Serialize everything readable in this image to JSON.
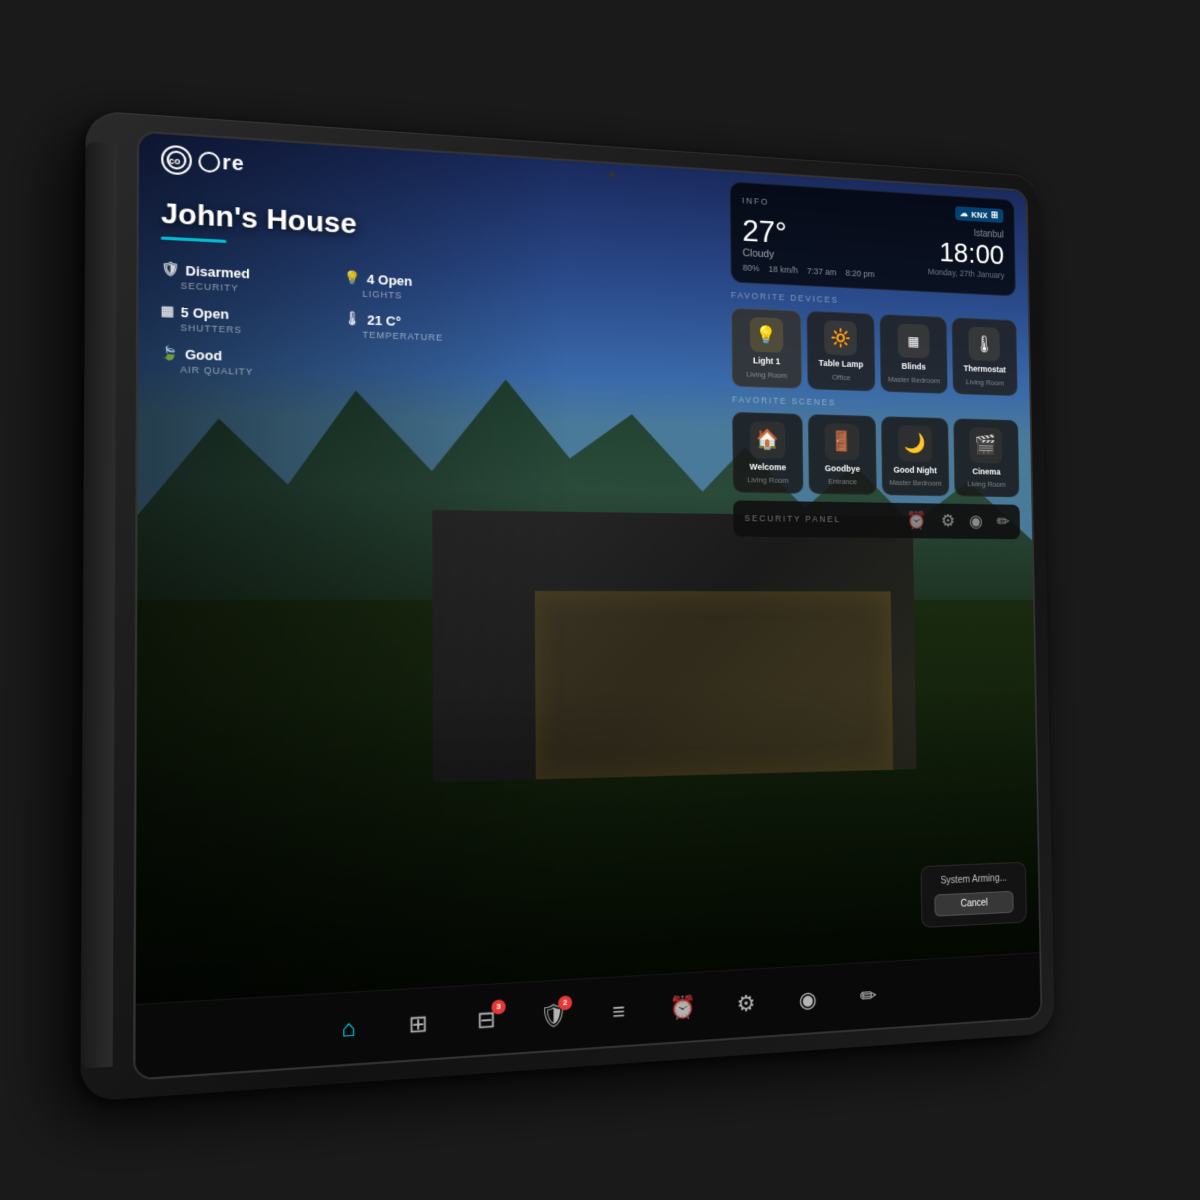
{
  "app": {
    "logo_text": "core",
    "brand": "#00bcd4"
  },
  "header": {
    "logo": "core"
  },
  "home": {
    "title": "John's House",
    "status": {
      "security_label": "SECURITY",
      "security_value": "Disarmed",
      "lights_label": "LIGHTS",
      "lights_value": "4 Open",
      "shutters_label": "SHUTTERS",
      "shutters_value": "5 Open",
      "temperature_label": "TEMPERATURE",
      "temperature_value": "21 C°",
      "air_quality_label": "AIR QUALITY",
      "air_quality_value": "Good"
    }
  },
  "weather": {
    "section_label": "INFO",
    "knx_label": "KNX",
    "temperature": "27°",
    "condition": "Cloudy",
    "humidity": "80%",
    "wind": "18 km/h",
    "sunrise": "7:37 am",
    "sunset": "8:20 pm",
    "city": "Istanbul",
    "time": "18:00",
    "date": "Monday, 27th January"
  },
  "favorite_devices": {
    "label": "FAVORITE DEVICES",
    "items": [
      {
        "name": "Light 1",
        "room": "Living Room",
        "icon": "💡",
        "active": true
      },
      {
        "name": "Table Lamp",
        "room": "Office",
        "icon": "🔆",
        "active": false
      },
      {
        "name": "Blinds",
        "room": "Master Bedroom",
        "icon": "▦",
        "active": false
      },
      {
        "name": "Thermostat",
        "room": "Living Room",
        "icon": "🌡",
        "active": false
      }
    ]
  },
  "favorite_scenes": {
    "label": "FAVORITE SCENES",
    "items": [
      {
        "name": "Welcome",
        "room": "Living Room",
        "icon": "🏠"
      },
      {
        "name": "Goodbye",
        "room": "Entrance",
        "icon": "🚪"
      },
      {
        "name": "Good Night",
        "room": "Master Bedroom",
        "icon": "🌙"
      },
      {
        "name": "Cinema",
        "room": "Living Room",
        "icon": "🎬"
      }
    ]
  },
  "security_panel": {
    "label": "SECURITY PANEL"
  },
  "system_arming": {
    "text": "System Arming...",
    "cancel_label": "Cancel"
  },
  "bottom_nav": {
    "items": [
      {
        "icon": "⌂",
        "label": "home",
        "active": true,
        "badge": null
      },
      {
        "icon": "⊞",
        "label": "rooms",
        "active": false,
        "badge": null
      },
      {
        "icon": "⊟",
        "label": "devices",
        "active": false,
        "badge": "3"
      },
      {
        "icon": "🛡",
        "label": "security",
        "active": false,
        "badge": "2"
      },
      {
        "icon": "≡",
        "label": "scenes",
        "active": false,
        "badge": null
      },
      {
        "icon": "⏰",
        "label": "clock",
        "active": false,
        "badge": null
      },
      {
        "icon": "⚙",
        "label": "settings",
        "active": false,
        "badge": null
      },
      {
        "icon": "◉",
        "label": "grid",
        "active": false,
        "badge": null
      },
      {
        "icon": "✏",
        "label": "edit",
        "active": false,
        "badge": null
      }
    ]
  }
}
